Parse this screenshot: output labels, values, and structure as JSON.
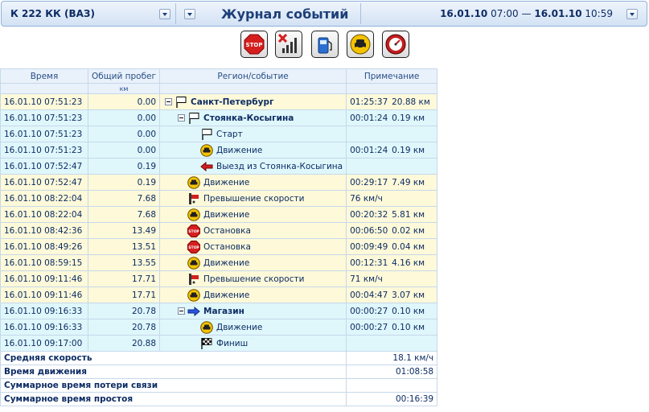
{
  "header": {
    "vehicle": "К 222 КК (ВАЗ)",
    "title": "Журнал событий",
    "period_from_date": "16.01.10",
    "period_from_time": "07:00",
    "period_dash": "—",
    "period_to_date": "16.01.10",
    "period_to_time": "10:59"
  },
  "toolbar": {
    "items": [
      {
        "name": "stop-filter-icon"
      },
      {
        "name": "signal-loss-filter-icon"
      },
      {
        "name": "fuel-filter-icon"
      },
      {
        "name": "movement-filter-icon"
      },
      {
        "name": "speedometer-filter-icon"
      }
    ]
  },
  "table": {
    "headers": {
      "time": "Время",
      "mileage": "Общий пробег",
      "mileage_unit": "км",
      "region": "Регион/событие",
      "note": "Примечание"
    },
    "rows": [
      {
        "time": "16.01.10 07:51:23",
        "mileage": "0.00",
        "event": "Санкт-Петербург",
        "icon": "flag-icon",
        "level": 0,
        "expander": true,
        "bold": true,
        "note_time": "01:25:37",
        "note_val": "20.88 км",
        "color": "y"
      },
      {
        "time": "16.01.10 07:51:23",
        "mileage": "0.00",
        "event": "Стоянка-Косыгина",
        "icon": "flag-icon",
        "level": 1,
        "expander": true,
        "bold": true,
        "note_time": "00:01:24",
        "note_val": "0.19 км",
        "color": "b"
      },
      {
        "time": "16.01.10 07:51:23",
        "mileage": "0.00",
        "event": "Старт",
        "icon": "flag-icon",
        "level": 2,
        "expander": false,
        "bold": false,
        "note_time": "",
        "note_val": "",
        "color": "b"
      },
      {
        "time": "16.01.10 07:51:23",
        "mileage": "0.00",
        "event": "Движение",
        "icon": "car-icon",
        "level": 2,
        "expander": false,
        "bold": false,
        "note_time": "00:01:24",
        "note_val": "0.19 км",
        "color": "b"
      },
      {
        "time": "16.01.10 07:52:47",
        "mileage": "0.19",
        "event": "Выезд из Стоянка-Косыгина",
        "icon": "exit-arrow-icon",
        "level": 2,
        "expander": false,
        "bold": false,
        "note_time": "",
        "note_val": "",
        "color": "b"
      },
      {
        "time": "16.01.10 07:52:47",
        "mileage": "0.19",
        "event": "Движение",
        "icon": "car-icon",
        "level": 1,
        "expander": false,
        "bold": false,
        "note_time": "00:29:17",
        "note_val": "7.49 км",
        "color": "y"
      },
      {
        "time": "16.01.10 08:22:04",
        "mileage": "7.68",
        "event": "Превышение скорости",
        "icon": "speeding-icon",
        "level": 1,
        "expander": false,
        "bold": false,
        "note_time": "76 км/ч",
        "note_val": "",
        "color": "y"
      },
      {
        "time": "16.01.10 08:22:04",
        "mileage": "7.68",
        "event": "Движение",
        "icon": "car-icon",
        "level": 1,
        "expander": false,
        "bold": false,
        "note_time": "00:20:32",
        "note_val": "5.81 км",
        "color": "y"
      },
      {
        "time": "16.01.10 08:42:36",
        "mileage": "13.49",
        "event": "Остановка",
        "icon": "stop-icon",
        "level": 1,
        "expander": false,
        "bold": false,
        "note_time": "00:06:50",
        "note_val": "0.02 км",
        "color": "y"
      },
      {
        "time": "16.01.10 08:49:26",
        "mileage": "13.51",
        "event": "Остановка",
        "icon": "stop-icon",
        "level": 1,
        "expander": false,
        "bold": false,
        "note_time": "00:09:49",
        "note_val": "0.04 км",
        "color": "y"
      },
      {
        "time": "16.01.10 08:59:15",
        "mileage": "13.55",
        "event": "Движение",
        "icon": "car-icon",
        "level": 1,
        "expander": false,
        "bold": false,
        "note_time": "00:12:31",
        "note_val": "4.16 км",
        "color": "y"
      },
      {
        "time": "16.01.10 09:11:46",
        "mileage": "17.71",
        "event": "Превышение скорости",
        "icon": "speeding-icon",
        "level": 1,
        "expander": false,
        "bold": false,
        "note_time": "71 км/ч",
        "note_val": "",
        "color": "y"
      },
      {
        "time": "16.01.10 09:11:46",
        "mileage": "17.71",
        "event": "Движение",
        "icon": "car-icon",
        "level": 1,
        "expander": false,
        "bold": false,
        "note_time": "00:04:47",
        "note_val": "3.07 км",
        "color": "y"
      },
      {
        "time": "16.01.10 09:16:33",
        "mileage": "20.78",
        "event": "Магазин",
        "icon": "arrow-right-icon",
        "level": 1,
        "expander": true,
        "bold": true,
        "note_time": "00:00:27",
        "note_val": "0.10 км",
        "color": "b"
      },
      {
        "time": "16.01.10 09:16:33",
        "mileage": "20.78",
        "event": "Движение",
        "icon": "car-icon",
        "level": 2,
        "expander": false,
        "bold": false,
        "note_time": "00:00:27",
        "note_val": "0.10 км",
        "color": "b"
      },
      {
        "time": "16.01.10 09:17:00",
        "mileage": "20.88",
        "event": "Финиш",
        "icon": "finish-flag-icon",
        "level": 2,
        "expander": false,
        "bold": false,
        "note_time": "",
        "note_val": "",
        "color": "b"
      }
    ]
  },
  "footer": [
    {
      "label": "Средняя скорость",
      "value": "18.1 км/ч"
    },
    {
      "label": "Время движения",
      "value": "01:08:58"
    },
    {
      "label": "Суммарное время потери связи",
      "value": ""
    },
    {
      "label": "Суммарное время простоя",
      "value": "00:16:39"
    }
  ]
}
